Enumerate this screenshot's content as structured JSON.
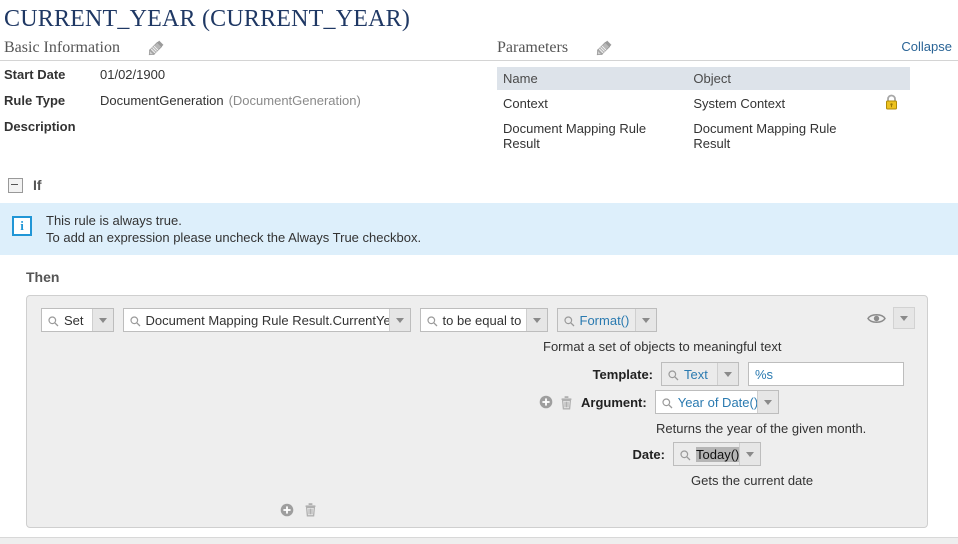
{
  "page": {
    "title": "CURRENT_YEAR (CURRENT_YEAR)"
  },
  "basic_information": {
    "heading": "Basic Information",
    "edit_icon": "pencil-icon",
    "fields": [
      {
        "label": "Start Date",
        "value": "01/02/1900",
        "value_muted": ""
      },
      {
        "label": "Rule Type",
        "value": "DocumentGeneration",
        "value_muted": "(DocumentGeneration)"
      },
      {
        "label": "Description",
        "value": "",
        "value_muted": ""
      }
    ]
  },
  "parameters": {
    "heading": "Parameters",
    "edit_icon": "pencil-icon",
    "columns": [
      "Name",
      "Object"
    ],
    "rows": [
      {
        "name": "Context",
        "object": "System Context",
        "locked": true,
        "lock_icon": "lock-icon"
      },
      {
        "name": "Document Mapping Rule Result",
        "object": "Document Mapping Rule Result",
        "locked": false,
        "lock_icon": ""
      }
    ]
  },
  "collapse": {
    "label": "Collapse"
  },
  "if_section": {
    "toggle_icon": "collapse-minus-icon",
    "label": "If",
    "banner": {
      "icon": "info-icon",
      "line1": "This rule is always true.",
      "line2": "To add an expression please uncheck the Always True checkbox."
    }
  },
  "then_section": {
    "label": "Then",
    "action_row": {
      "operation": {
        "value": "Set",
        "search_icon": "search-icon",
        "caret_icon": "chevron-down-icon"
      },
      "target": {
        "value": "Document Mapping Rule Result.CurrentYear",
        "search_icon": "search-icon",
        "caret_icon": "chevron-down-icon"
      },
      "operator": {
        "value": "to be equal to",
        "search_icon": "search-icon",
        "caret_icon": "chevron-down-icon"
      },
      "function": {
        "value": "Format()",
        "search_icon": "search-icon",
        "caret_icon": "chevron-down-icon"
      },
      "preview_icon": "eye-icon",
      "preview_caret_icon": "chevron-down-icon"
    },
    "function_description": "Format a set of objects to meaningful text",
    "template": {
      "label": "Template:",
      "type_value": "Text",
      "search_icon": "search-icon",
      "caret_icon": "chevron-down-icon",
      "input_value": "%s"
    },
    "argument": {
      "add_icon": "add-circle-icon",
      "delete_icon": "trash-icon",
      "label": "Argument:",
      "value": "Year of Date()",
      "search_icon": "search-icon",
      "caret_icon": "chevron-down-icon",
      "description": "Returns the year of the given month."
    },
    "date": {
      "label": "Date:",
      "value": "Today()",
      "search_icon": "search-icon",
      "caret_icon": "chevron-down-icon",
      "description": "Gets the current date"
    },
    "footer": {
      "add_icon": "add-circle-icon",
      "delete_icon": "trash-icon"
    }
  },
  "colors": {
    "title": "#1f3864",
    "link": "#2a6496",
    "banner_bg": "#ddeffb",
    "banner_icon": "#2196d6",
    "table_header_bg": "#dde3ea",
    "panel_bg": "#eeeeee",
    "field_blue_text": "#2a7ab0",
    "lock_gold": "#e8b020"
  }
}
